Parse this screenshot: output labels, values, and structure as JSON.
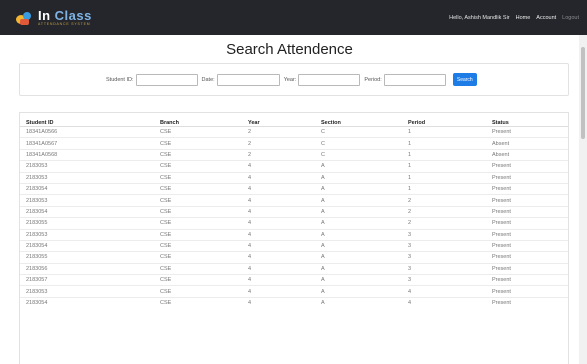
{
  "app": {
    "logo_title_main": "In ",
    "logo_title_accent": "Class",
    "logo_subtitle": "ATTENDANCE SYSTEM"
  },
  "nav": {
    "greeting": "Hello, Ashish Mandlik Sir",
    "home": "Home",
    "account": "Account",
    "logout": "Logout"
  },
  "page": {
    "title": "Search Attendence"
  },
  "filters": {
    "student_id_label": "Student ID:",
    "student_id_value": "",
    "date_label": "Date:",
    "date_value": "",
    "year_label": "Year:",
    "year_value": "",
    "period_label": "Period:",
    "period_value": "",
    "search_button": "Search"
  },
  "table": {
    "headers": [
      "Student ID",
      "Branch",
      "Year",
      "Section",
      "Period",
      "Status"
    ],
    "rows": [
      [
        "18341A0566",
        "CSE",
        "2",
        "C",
        "1",
        "Present"
      ],
      [
        "18341A0567",
        "CSE",
        "2",
        "C",
        "1",
        "Absent"
      ],
      [
        "18341A0568",
        "CSE",
        "2",
        "C",
        "1",
        "Absent"
      ],
      [
        "2183053",
        "CSE",
        "4",
        "A",
        "1",
        "Present"
      ],
      [
        "2183053",
        "CSE",
        "4",
        "A",
        "1",
        "Present"
      ],
      [
        "2183054",
        "CSE",
        "4",
        "A",
        "1",
        "Present"
      ],
      [
        "2183053",
        "CSE",
        "4",
        "A",
        "2",
        "Present"
      ],
      [
        "2183054",
        "CSE",
        "4",
        "A",
        "2",
        "Present"
      ],
      [
        "2183055",
        "CSE",
        "4",
        "A",
        "2",
        "Present"
      ],
      [
        "2183053",
        "CSE",
        "4",
        "A",
        "3",
        "Present"
      ],
      [
        "2183054",
        "CSE",
        "4",
        "A",
        "3",
        "Present"
      ],
      [
        "2183055",
        "CSE",
        "4",
        "A",
        "3",
        "Present"
      ],
      [
        "2183056",
        "CSE",
        "4",
        "A",
        "3",
        "Present"
      ],
      [
        "2183057",
        "CSE",
        "4",
        "A",
        "3",
        "Present"
      ],
      [
        "2183053",
        "CSE",
        "4",
        "A",
        "4",
        "Present"
      ],
      [
        "2183054",
        "CSE",
        "4",
        "A",
        "4",
        "Present"
      ]
    ]
  }
}
